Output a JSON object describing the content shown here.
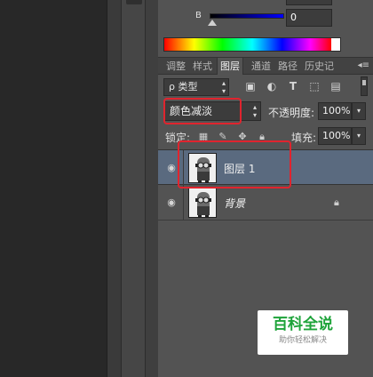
{
  "color": {
    "b_label": "B",
    "b_value": "0"
  },
  "tabs": [
    {
      "label": "调整"
    },
    {
      "label": "样式"
    },
    {
      "label": "图层",
      "active": true
    },
    {
      "label": "通道"
    },
    {
      "label": "路径"
    },
    {
      "label": "历史记"
    }
  ],
  "filter": {
    "kind_label": "ρ 类型",
    "icons": [
      "image-filter-icon",
      "adjustment-filter-icon",
      "type-filter-icon",
      "shape-filter-icon",
      "smart-object-filter-icon"
    ]
  },
  "blend": {
    "mode": "颜色减淡",
    "opacity_label": "不透明度:",
    "opacity_value": "100%"
  },
  "lock": {
    "label": "锁定:",
    "fill_label": "填充:",
    "fill_value": "100%"
  },
  "layers": [
    {
      "name": "图层 1",
      "selected": true,
      "visible": true
    },
    {
      "name": "背景",
      "selected": false,
      "visible": true,
      "locked": true
    }
  ],
  "watermark": {
    "title": "百科全说",
    "subtitle": "助你轻松解决"
  },
  "colors": {
    "panel_bg": "#535353",
    "selected_layer": "#5a6a7f",
    "highlight": "#e0242e",
    "watermark_green": "#1ea33a"
  }
}
